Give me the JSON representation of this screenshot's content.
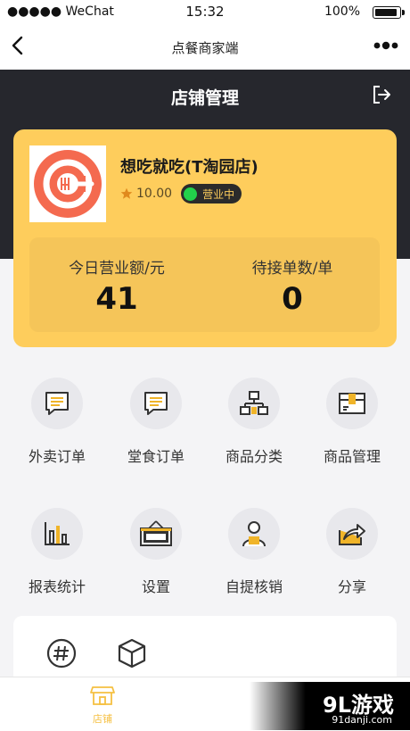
{
  "status_bar": {
    "carrier": "●●●●● WeChat",
    "time": "15:32",
    "battery": "100%"
  },
  "nav": {
    "title": "点餐商家端"
  },
  "header": {
    "title": "店铺管理"
  },
  "store": {
    "name": "想吃就吃(T淘园店)",
    "rating": "10.00",
    "status": "营业中"
  },
  "stats": {
    "revenue_label": "今日营业额/元",
    "revenue_value": "41",
    "pending_label": "待接单数/单",
    "pending_value": "0"
  },
  "menu": [
    {
      "label": "外卖订单",
      "icon": "takeout-order-icon"
    },
    {
      "label": "堂食订单",
      "icon": "dine-in-order-icon"
    },
    {
      "label": "商品分类",
      "icon": "category-icon"
    },
    {
      "label": "商品管理",
      "icon": "product-manage-icon"
    },
    {
      "label": "报表统计",
      "icon": "report-chart-icon"
    },
    {
      "label": "设置",
      "icon": "open-sign-icon"
    },
    {
      "label": "自提核销",
      "icon": "pickup-verify-icon"
    },
    {
      "label": "分享",
      "icon": "share-icon"
    }
  ],
  "more_icons": [
    "hash-icon",
    "box-icon"
  ],
  "tab_bar": {
    "shop_label": "店铺"
  },
  "watermark": {
    "brand": "9L游戏",
    "url": "91danji.com"
  },
  "colors": {
    "accent": "#fecd5c",
    "dark_header": "#26272d",
    "open_dot": "#22d14b"
  }
}
